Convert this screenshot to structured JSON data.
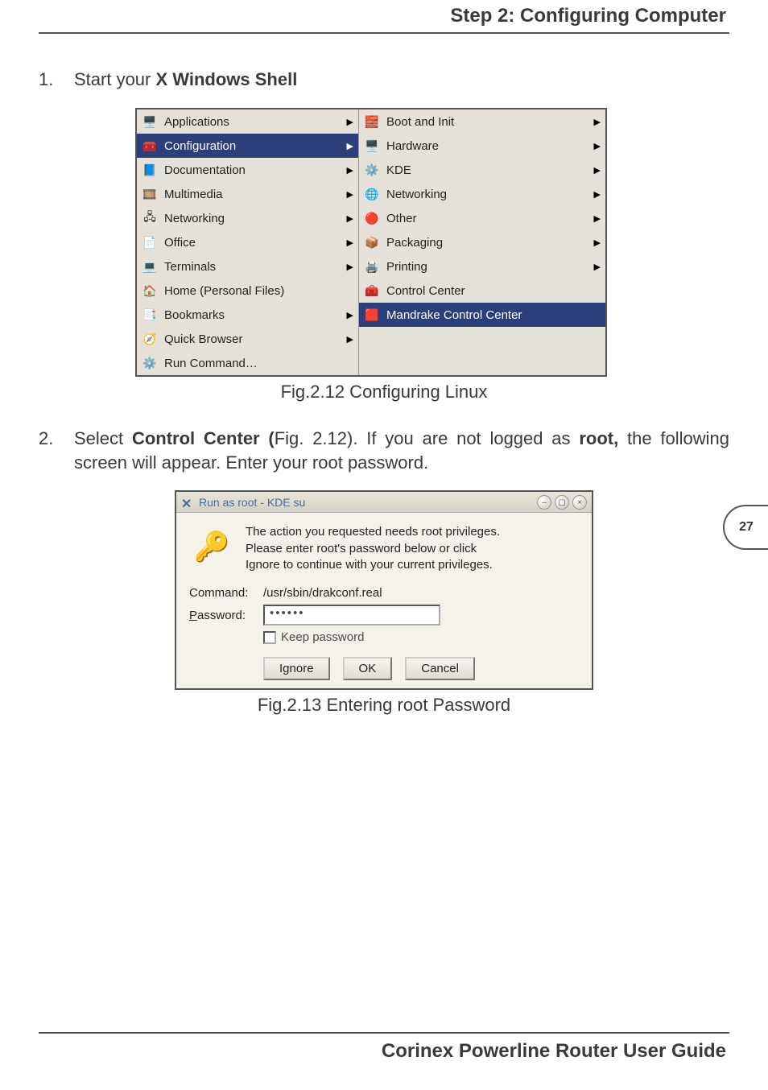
{
  "header": "Step 2: Configuring Computer",
  "step1": {
    "num": "1.",
    "prefix": "Start your ",
    "bold": "X Windows Shell"
  },
  "menu1": [
    {
      "icon": "🖥️",
      "label": "Applications",
      "sel": false,
      "arrow": true
    },
    {
      "icon": "🧰",
      "label": "Configuration",
      "sel": true,
      "arrow": true
    },
    {
      "icon": "📘",
      "label": "Documentation",
      "sel": false,
      "arrow": true
    },
    {
      "icon": "🎞️",
      "label": "Multimedia",
      "sel": false,
      "arrow": true
    },
    {
      "icon": "🖧",
      "label": "Networking",
      "sel": false,
      "arrow": true
    },
    {
      "icon": "📄",
      "label": "Office",
      "sel": false,
      "arrow": true
    },
    {
      "icon": "💻",
      "label": "Terminals",
      "sel": false,
      "arrow": true
    },
    {
      "icon": "🏠",
      "label": "Home (Personal Files)",
      "sel": false,
      "arrow": false
    },
    {
      "icon": "📑",
      "label": "Bookmarks",
      "sel": false,
      "arrow": true
    },
    {
      "icon": "🧭",
      "label": "Quick Browser",
      "sel": false,
      "arrow": true
    },
    {
      "icon": "⚙️",
      "label": "Run Command…",
      "sel": false,
      "arrow": false
    }
  ],
  "menu2": [
    {
      "icon": "🧱",
      "label": "Boot and Init",
      "sel": false,
      "arrow": true
    },
    {
      "icon": "🖥️",
      "label": "Hardware",
      "sel": false,
      "arrow": true
    },
    {
      "icon": "⚙️",
      "label": "KDE",
      "sel": false,
      "arrow": true
    },
    {
      "icon": "🌐",
      "label": "Networking",
      "sel": false,
      "arrow": true
    },
    {
      "icon": "🔴",
      "label": "Other",
      "sel": false,
      "arrow": true
    },
    {
      "icon": "📦",
      "label": "Packaging",
      "sel": false,
      "arrow": true
    },
    {
      "icon": "🖨️",
      "label": "Printing",
      "sel": false,
      "arrow": true
    },
    {
      "icon": "🧰",
      "label": "Control Center",
      "sel": false,
      "arrow": false
    },
    {
      "icon": "🟥",
      "label": "Mandrake Control Center",
      "sel": true,
      "arrow": false
    }
  ],
  "fig1_caption": "Fig.2.12 Configuring Linux",
  "step2": {
    "num": "2.",
    "t1": "Select ",
    "t2": "Control Center (",
    "t3": "Fig. 2.12). If you are not logged as ",
    "t4": "root,",
    "t5": " the following screen will appear. Enter your root password."
  },
  "dialog": {
    "title": "Run as root - KDE su",
    "msg1": "The action you requested needs root privileges.",
    "msg2": "Please enter root's password below or click",
    "msg3": "Ignore to continue with your current privileges.",
    "command_label": "Command:",
    "command_val": "/usr/sbin/drakconf.real",
    "password_label_pre": "P",
    "password_label_rest": "assword:",
    "password_val": "••••••",
    "keep_pre": "K",
    "keep_rest": "eep password",
    "btn_ignore_pre": "I",
    "btn_ignore_rest": "gnore",
    "btn_ok_pre": "O",
    "btn_ok_rest": "K",
    "btn_cancel_pre": "C",
    "btn_cancel_rest": "ancel"
  },
  "fig2_caption": "Fig.2.13 Entering root Password",
  "page_number": "27",
  "footer": "Corinex Powerline Router User Guide"
}
